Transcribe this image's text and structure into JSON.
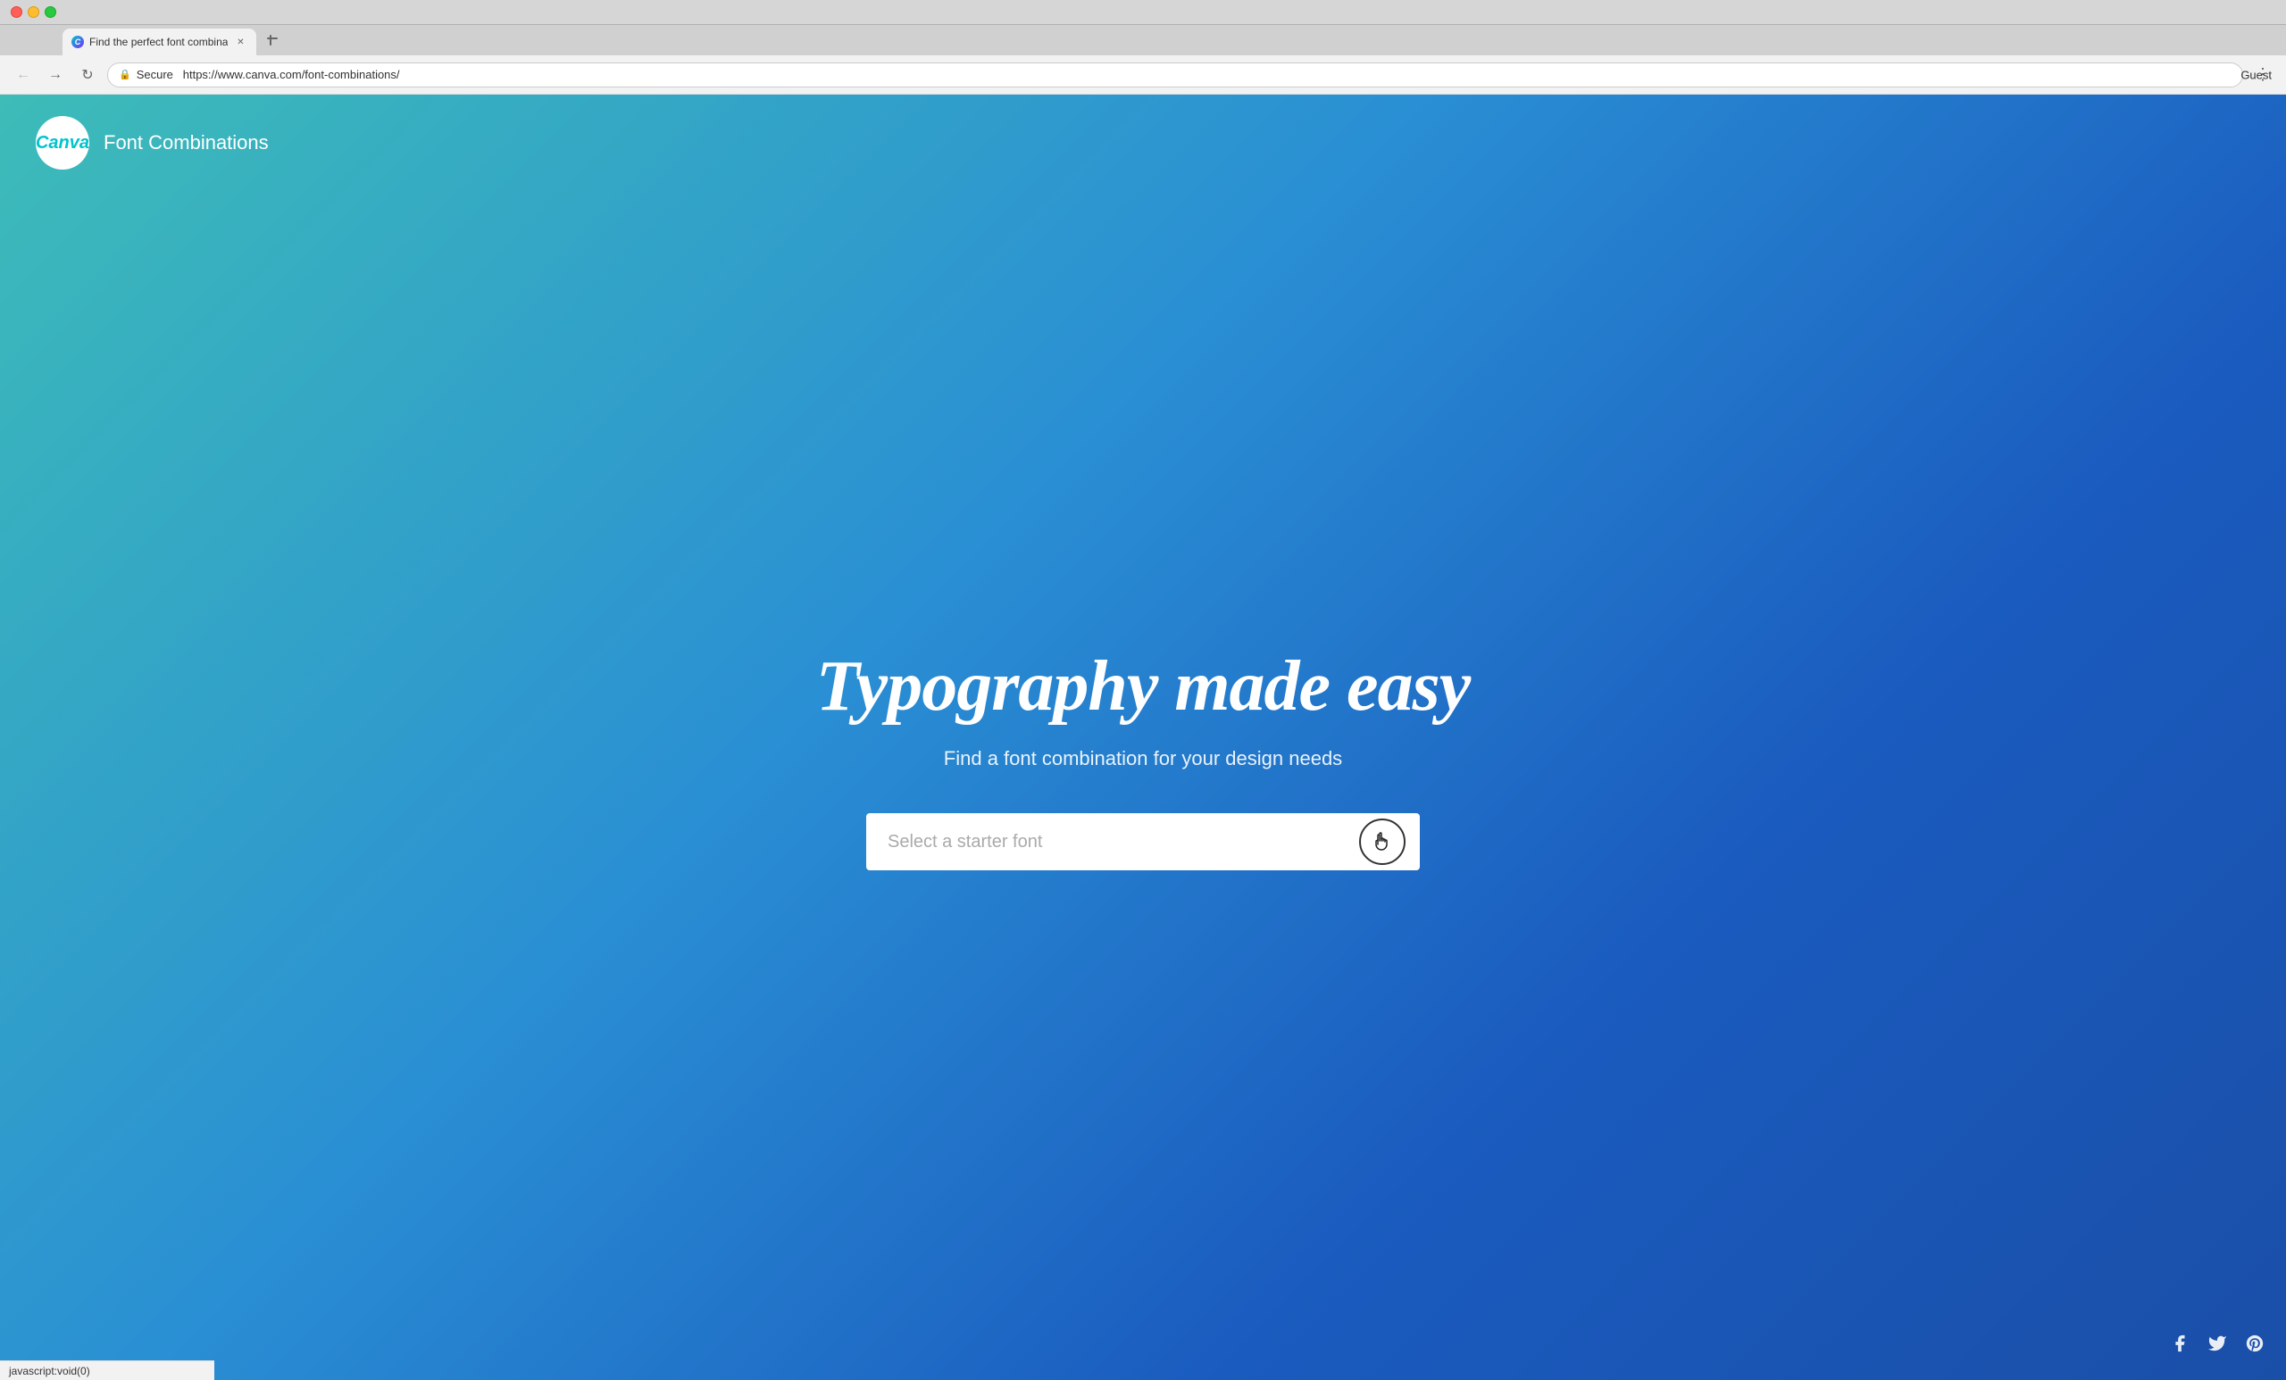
{
  "browser": {
    "tab_title": "Find the perfect font combina",
    "tab_favicon": "C",
    "url_protocol": "Secure",
    "url": "https://www.canva.com/font-combinations/",
    "guest_label": "Guest",
    "new_tab_icon": "+"
  },
  "header": {
    "logo_text": "Canva",
    "site_name": "Font Combinations"
  },
  "hero": {
    "title": "Typography made easy",
    "subtitle": "Find a font combination for your design needs"
  },
  "font_selector": {
    "placeholder": "Select a starter font"
  },
  "social": {
    "facebook_icon": "facebook",
    "twitter_icon": "twitter",
    "pinterest_icon": "pinterest"
  },
  "status_bar": {
    "text": "javascript:void(0)"
  }
}
